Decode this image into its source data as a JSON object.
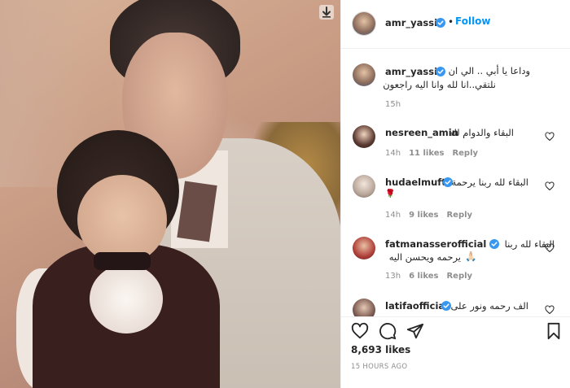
{
  "post": {
    "author": "amr_yassin",
    "follow_label": "Follow",
    "dot": "•",
    "caption_line1": "وداعا يا أبي .. الي ان",
    "caption_line2": "نلتقي..انا لله وانا اليه راجعون",
    "caption_time": "15h",
    "likes": "8,693 likes",
    "posted_ago": "15 HOURS AGO"
  },
  "comments": [
    {
      "user": "nesreen_amin",
      "text": "البقاء والدوام لله",
      "time": "14h",
      "likes": "11 likes",
      "reply": "Reply"
    },
    {
      "user": "hudaelmufti",
      "text": "البقاء لله ربنا يرحمة",
      "emoji": "🌹",
      "time": "14h",
      "likes": "9 likes",
      "reply": "Reply"
    },
    {
      "user": "fatmanasserofficial",
      "text": "البقاء لله ربنا",
      "text2": "يرحمه ويحسن اليه",
      "emoji": "🙏🏻",
      "time": "13h",
      "likes": "6 likes",
      "reply": "Reply"
    },
    {
      "user": "latifaofficial",
      "text": "الف رحمه ونور على"
    }
  ],
  "icons": {
    "download": "download-arrow-icon",
    "verified": "verified-badge-icon",
    "like": "heart-icon",
    "comment": "comment-bubble-icon",
    "share": "paper-plane-icon",
    "save": "bookmark-icon"
  },
  "colors": {
    "accent": "#0095f6",
    "verified": "#3897f0",
    "muted": "#8e8e8e",
    "text": "#262626"
  }
}
